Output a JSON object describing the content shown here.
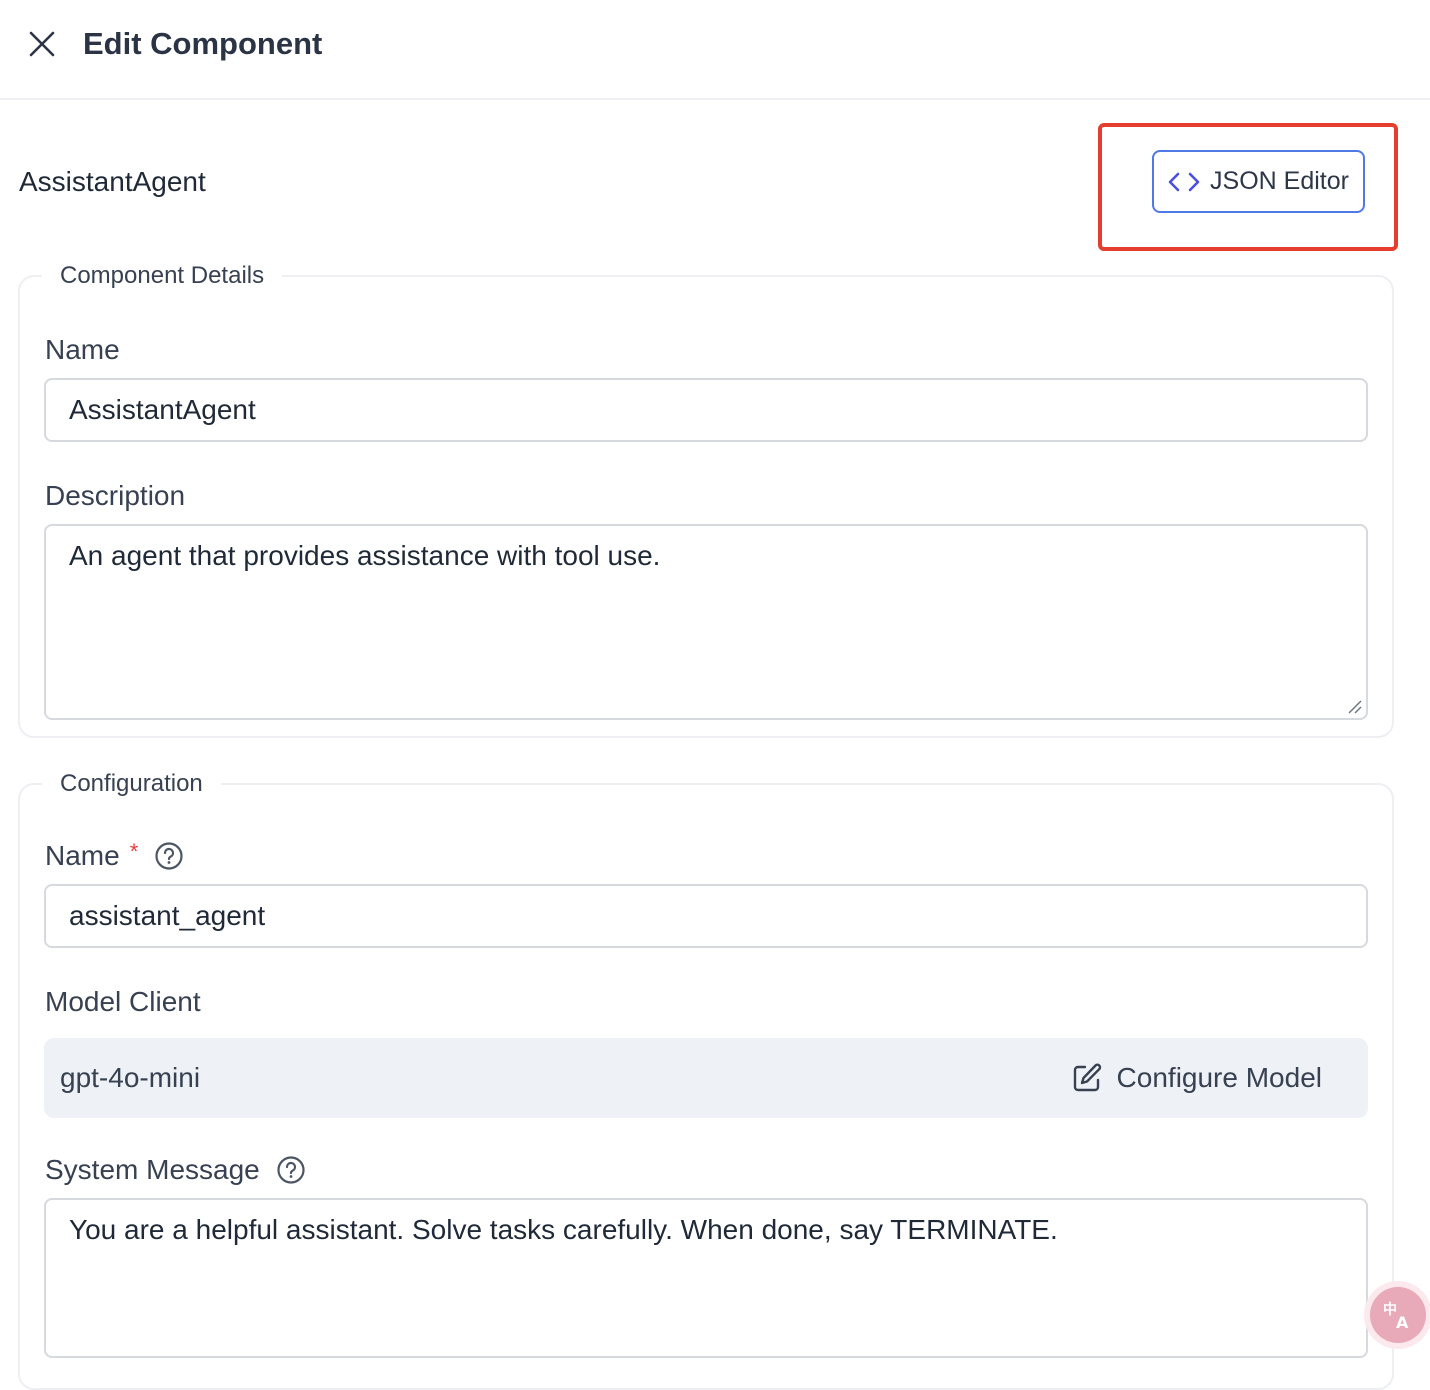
{
  "header": {
    "title": "Edit Component"
  },
  "component": {
    "type_label": "AssistantAgent",
    "json_editor_label": "JSON Editor"
  },
  "details": {
    "legend": "Component Details",
    "name_label": "Name",
    "name_value": "AssistantAgent",
    "description_label": "Description",
    "description_value": "An agent that provides assistance with tool use."
  },
  "configuration": {
    "legend": "Configuration",
    "name_label": "Name",
    "required_marker": "*",
    "name_value": "assistant_agent",
    "model_client_label": "Model Client",
    "model_name": "gpt-4o-mini",
    "configure_model_label": "Configure Model",
    "system_message_label": "System Message",
    "system_message_value": "You are a helpful assistant. Solve tasks carefully. When done, say TERMINATE."
  },
  "icons": {
    "close": "close-icon",
    "code": "code-icon",
    "help": "help-circle-icon",
    "edit": "edit-icon",
    "translate": "translate-icon"
  },
  "colors": {
    "highlight": "#e53e2f",
    "button_border": "#4f79e6",
    "required": "#e53e3e",
    "model_bar_bg": "#eef1f5"
  }
}
